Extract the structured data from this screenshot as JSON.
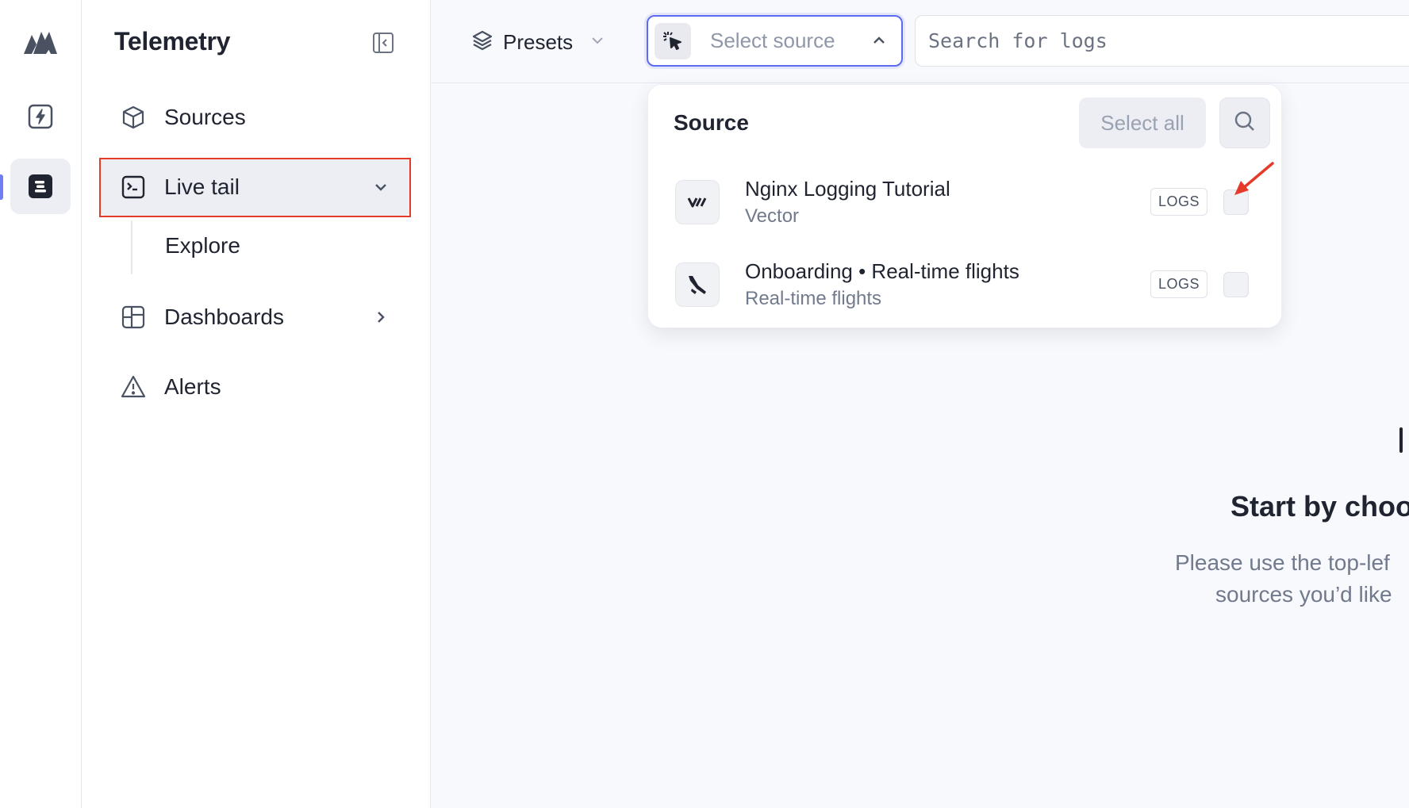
{
  "app": {
    "section_title": "Telemetry"
  },
  "sidebar": {
    "items": [
      {
        "label": "Sources",
        "icon": "cube-icon"
      },
      {
        "label": "Live tail",
        "icon": "terminal-icon",
        "active": true
      },
      {
        "label": "Explore",
        "sub": true
      },
      {
        "label": "Dashboards",
        "icon": "dashboard-icon"
      },
      {
        "label": "Alerts",
        "icon": "alert-triangle-icon"
      }
    ]
  },
  "toolbar": {
    "presets_label": "Presets",
    "select_source_placeholder": "Select source",
    "search_placeholder": "Search for logs"
  },
  "source_dropdown": {
    "title": "Source",
    "select_all_label": "Select all",
    "sources": [
      {
        "name": "Nginx Logging Tutorial",
        "subtitle": "Vector",
        "badge": "LOGS",
        "checked": false
      },
      {
        "name": "Onboarding • Real-time flights",
        "subtitle": "Real-time flights",
        "badge": "LOGS",
        "checked": false
      }
    ]
  },
  "empty_state": {
    "title": "Start by choo",
    "line1": "Please use the top-lef",
    "line2": "sources you’d like"
  },
  "colors": {
    "accent": "#5b6cf0",
    "highlight": "#e53a2a",
    "text": "#1f2430",
    "muted": "#717a8c"
  }
}
